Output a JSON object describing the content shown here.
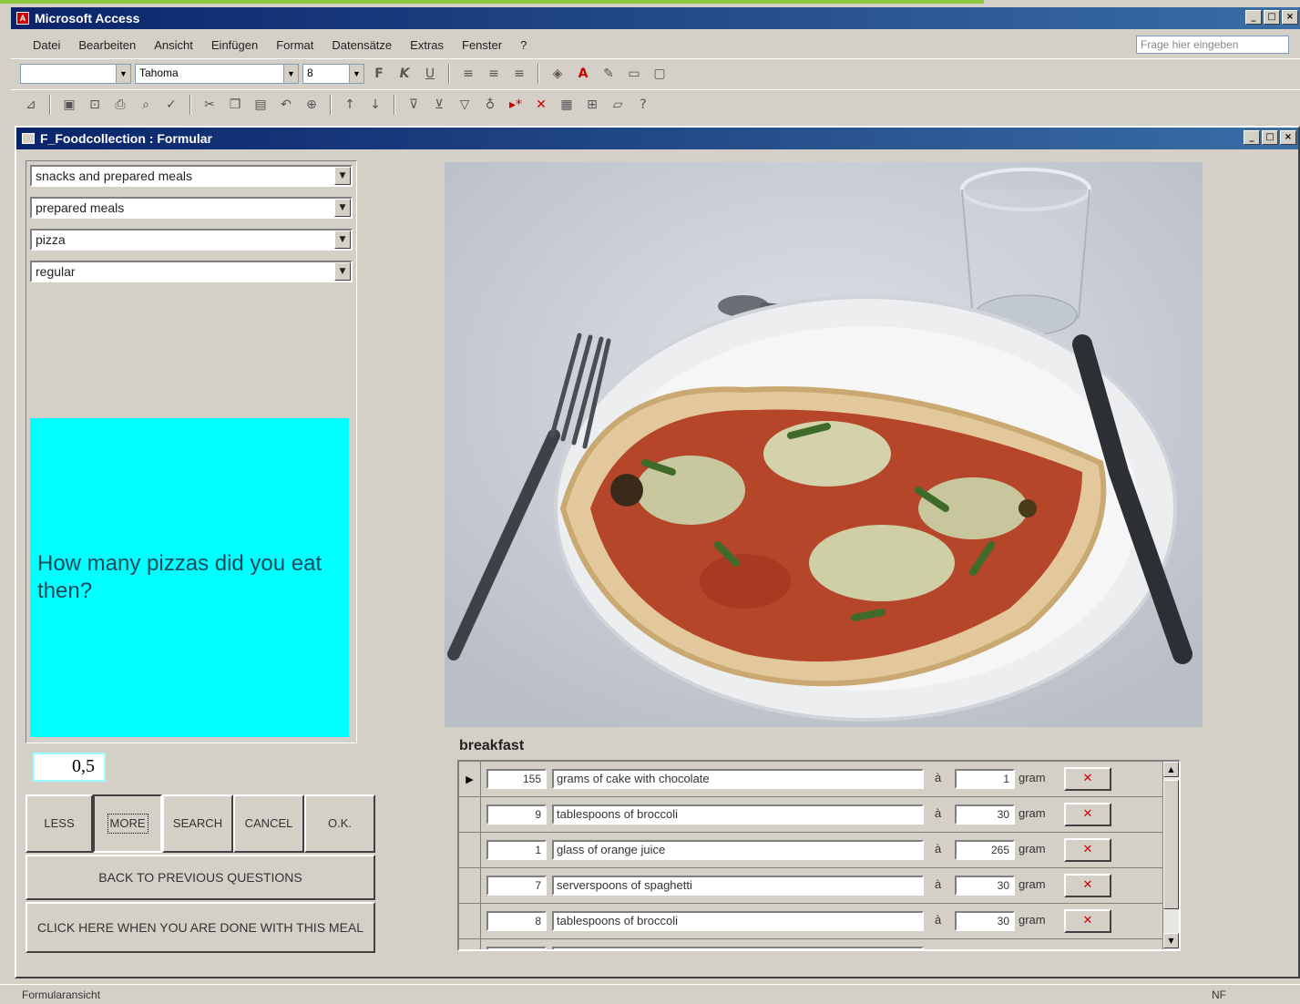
{
  "app": {
    "title": "Microsoft Access",
    "help_placeholder": "Frage hier eingeben"
  },
  "menu": [
    "Datei",
    "Bearbeiten",
    "Ansicht",
    "Einfügen",
    "Format",
    "Datensätze",
    "Extras",
    "Fenster",
    "?"
  ],
  "toolbar": {
    "font": "Tahoma",
    "size": "8",
    "bold": "F",
    "italic": "K",
    "underline": "U"
  },
  "form": {
    "title": "F_Foodcollection : Formular",
    "combos": [
      "snacks and prepared meals",
      "prepared meals",
      "pizza",
      "regular"
    ],
    "question": "How many pizzas did you eat then?",
    "quantity": "0,5",
    "buttons": {
      "less": "LESS",
      "more": "MORE",
      "search": "SEARCH",
      "cancel": "CANCEL",
      "ok": "O.K.",
      "back": "BACK TO PREVIOUS QUESTIONS",
      "done": "CLICK HERE WHEN YOU ARE DONE WITH THIS MEAL"
    },
    "meal_label": "breakfast",
    "meal_rows": [
      {
        "qty": "155",
        "desc": "grams of cake with chocolate",
        "a": "à",
        "value": "1",
        "unit": "gram"
      },
      {
        "qty": "9",
        "desc": "tablespoons of broccoli",
        "a": "à",
        "value": "30",
        "unit": "gram"
      },
      {
        "qty": "1",
        "desc": "glass of orange juice",
        "a": "à",
        "value": "265",
        "unit": "gram"
      },
      {
        "qty": "7",
        "desc": "serverspoons of spaghetti",
        "a": "à",
        "value": "30",
        "unit": "gram"
      },
      {
        "qty": "8",
        "desc": "tablespoons of broccoli",
        "a": "à",
        "value": "30",
        "unit": "gram"
      }
    ]
  },
  "status": {
    "left": "Formularansicht",
    "right": "NF"
  }
}
